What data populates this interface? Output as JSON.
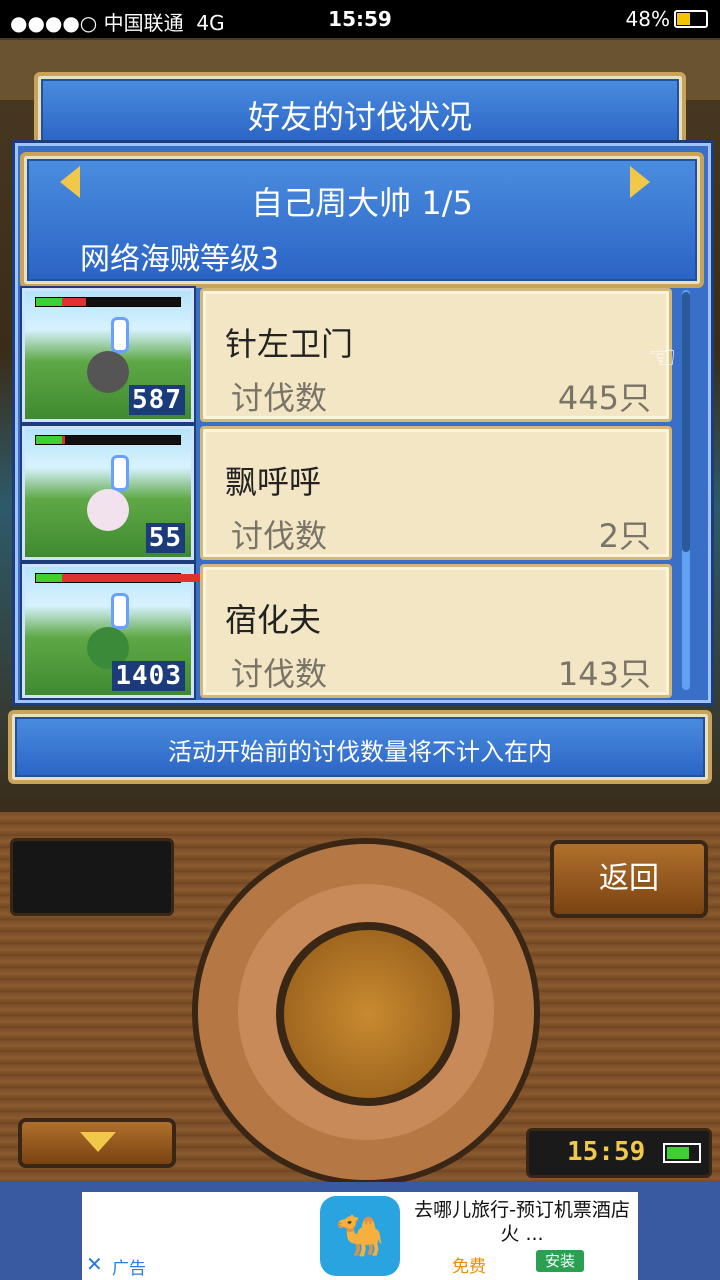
{
  "status_bar": {
    "signal": "●●●●○",
    "carrier": "中国联通",
    "network": "4G",
    "time": "15:59",
    "battery": "48%"
  },
  "dialog": {
    "title": "好友的讨伐状况",
    "friend_name": "自己周大帅 1/5",
    "friend_rank": "网络海贼等级3",
    "notice": "活动开始前的讨伐数量将不计入在内"
  },
  "rows": [
    {
      "name": "针左卫门",
      "label": "讨伐数",
      "value": "445只",
      "level": "587",
      "hp_fraction": 0.17,
      "hp_color": "#e03030",
      "monster_color": "#555"
    },
    {
      "name": "飘呼呼",
      "label": "讨伐数",
      "value": "2只",
      "level": "55",
      "hp_fraction": 0.02,
      "hp_color": "#e03030",
      "monster_color": "#f2e2ee"
    },
    {
      "name": "宿化夫",
      "label": "讨伐数",
      "value": "143只",
      "level": "1403",
      "hp_fraction": 0.99,
      "hp_color": "#e03030",
      "monster_color": "#3a8a3a"
    }
  ],
  "controls": {
    "back_label": "返回",
    "clock": "15:59"
  },
  "ad": {
    "title": "去哪儿旅行-预订机票酒店火 ...",
    "free": "免费",
    "install": "安装",
    "close": "✕",
    "label": "广告"
  }
}
